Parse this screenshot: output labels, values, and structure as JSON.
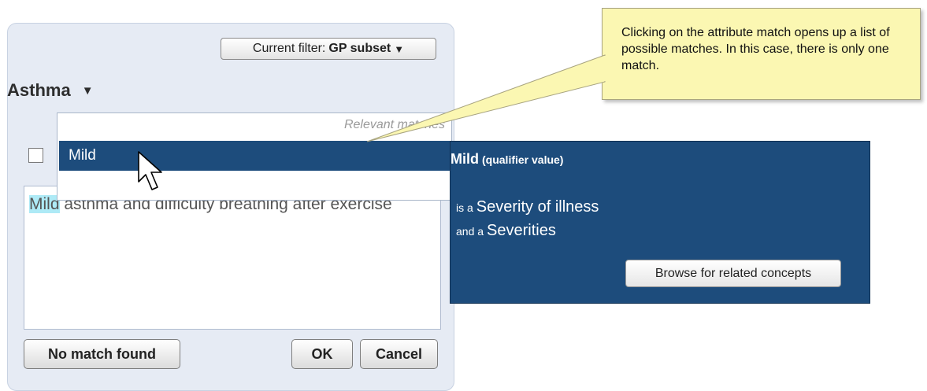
{
  "dialog": {
    "filter_prefix": "Current filter:",
    "filter_value": "GP subset",
    "concept_title": "Asthma",
    "text_highlight": "Mild",
    "text_rest": " asthma and difficulty breathing after exercise",
    "no_match_label": "No match found",
    "ok_label": "OK",
    "cancel_label": "Cancel"
  },
  "dropdown": {
    "header": "Relevant matches",
    "items": [
      "Mild"
    ]
  },
  "info_panel": {
    "term": "Mild",
    "qualifier": "(qualifier value)",
    "relations": [
      {
        "prefix": "is a",
        "value": "Severity of illness"
      },
      {
        "prefix": "and a",
        "value": "Severities"
      }
    ],
    "browse_label": "Browse for related concepts"
  },
  "callout": {
    "text": "Clicking on the attribute match opens up a list of possible matches. In this case, there is only one match."
  },
  "colors": {
    "panel_bg": "#e6ebf4",
    "selection_blue": "#1d4c7c",
    "highlight": "#aeeaf6",
    "callout_bg": "#fbf7b2"
  }
}
